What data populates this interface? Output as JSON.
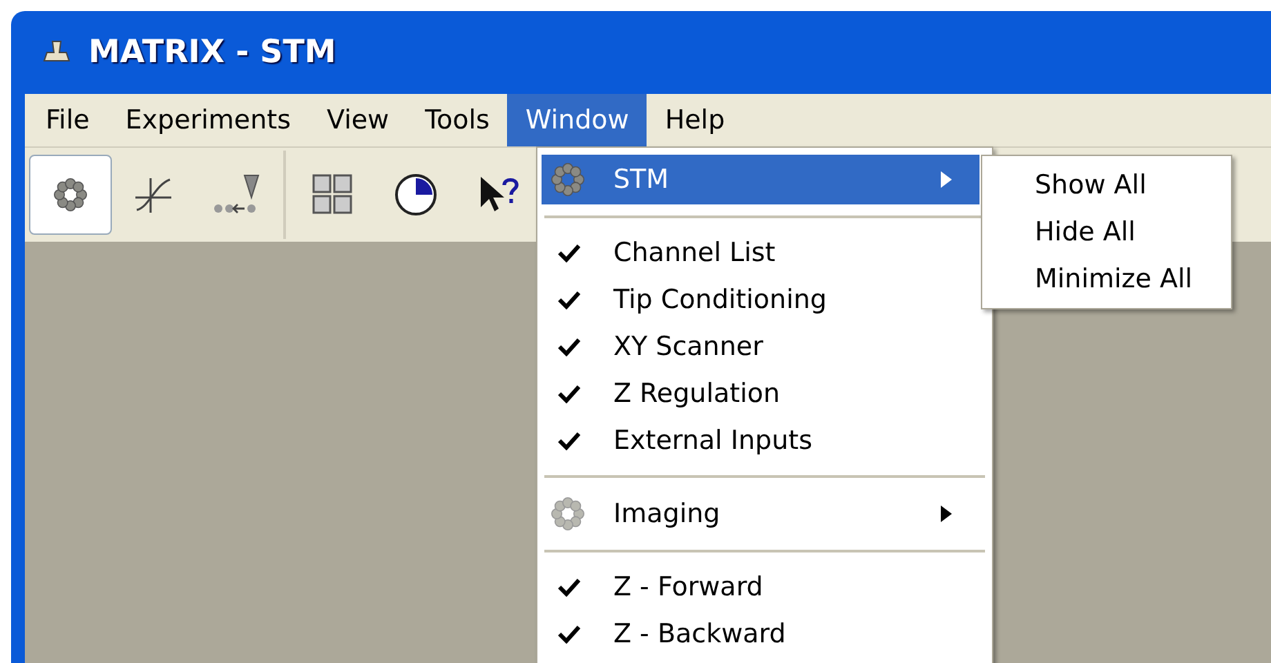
{
  "window": {
    "title": "MATRIX - STM"
  },
  "menubar": [
    {
      "label": "File",
      "selected": false
    },
    {
      "label": "Experiments",
      "selected": false
    },
    {
      "label": "View",
      "selected": false
    },
    {
      "label": "Tools",
      "selected": false
    },
    {
      "label": "Window",
      "selected": true
    },
    {
      "label": "Help",
      "selected": false
    }
  ],
  "toolbar": [
    {
      "selected": true
    },
    {
      "selected": false
    },
    {
      "selected": false
    },
    {
      "selected": false
    },
    {
      "selected": false
    },
    {
      "selected": false
    }
  ],
  "window_menu": [
    {
      "kind": "submenu",
      "label": "STM",
      "selected": true
    },
    {
      "kind": "separator"
    },
    {
      "kind": "check",
      "label": "Channel List",
      "checked": true
    },
    {
      "kind": "check",
      "label": "Tip Conditioning",
      "checked": true
    },
    {
      "kind": "check",
      "label": "XY Scanner",
      "checked": true
    },
    {
      "kind": "check",
      "label": "Z Regulation",
      "checked": true
    },
    {
      "kind": "check",
      "label": "External Inputs",
      "checked": true
    },
    {
      "kind": "separator"
    },
    {
      "kind": "submenu",
      "label": "Imaging",
      "selected": false
    },
    {
      "kind": "separator"
    },
    {
      "kind": "check",
      "label": "Z - Forward",
      "checked": true
    },
    {
      "kind": "check",
      "label": "Z - Backward",
      "checked": true
    }
  ],
  "submenu": [
    "Show All",
    "Hide All",
    "Minimize All"
  ]
}
